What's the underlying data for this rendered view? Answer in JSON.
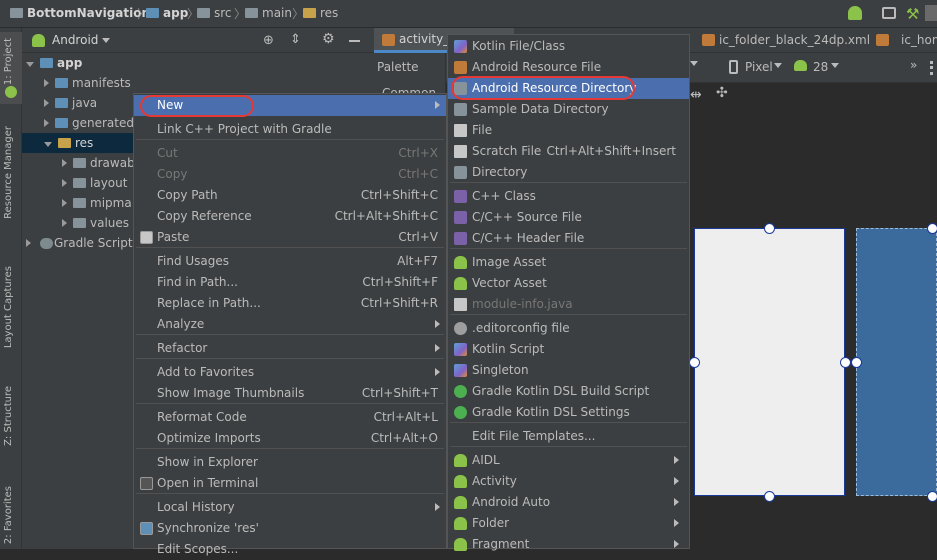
{
  "breadcrumb": {
    "project": "BottomNavigation",
    "module": "app",
    "p1": "src",
    "p2": "main",
    "p3": "res"
  },
  "left_strip": {
    "project": "1: Project",
    "resource_manager": "Resource Manager",
    "layout_captures": "Layout Captures",
    "structure": "Z: Structure",
    "favorites": "2: Favorites"
  },
  "project_panel": {
    "view_mode": "Android",
    "tree": [
      {
        "label": "app"
      },
      {
        "label": "manifests"
      },
      {
        "label": "java"
      },
      {
        "label": "generated"
      },
      {
        "label": "res"
      },
      {
        "label": "drawab"
      },
      {
        "label": "layout"
      },
      {
        "label": "mipma"
      },
      {
        "label": "values"
      },
      {
        "label": "Gradle Scripts"
      }
    ]
  },
  "editor": {
    "tabs": [
      "activity_m",
      "ic_folder_black_24dp.xml",
      "ic_hom"
    ],
    "palette": "Palette",
    "palette_item": "Common",
    "device": "Pixel",
    "api": "28"
  },
  "context_menu": [
    {
      "label": "New",
      "sc": "",
      "sub": true
    },
    {
      "label": "Link C++ Project with Gradle",
      "sc": ""
    },
    {
      "label": "Cut",
      "sc": "Ctrl+X",
      "disabled": true
    },
    {
      "label": "Copy",
      "sc": "Ctrl+C",
      "disabled": true
    },
    {
      "label": "Copy Path",
      "sc": "Ctrl+Shift+C"
    },
    {
      "label": "Copy Reference",
      "sc": "Ctrl+Alt+Shift+C"
    },
    {
      "label": "Paste",
      "sc": "Ctrl+V"
    },
    {
      "label": "Find Usages",
      "sc": "Alt+F7"
    },
    {
      "label": "Find in Path...",
      "sc": "Ctrl+Shift+F"
    },
    {
      "label": "Replace in Path...",
      "sc": "Ctrl+Shift+R"
    },
    {
      "label": "Analyze",
      "sc": "",
      "sub": true
    },
    {
      "label": "Refactor",
      "sc": "",
      "sub": true
    },
    {
      "label": "Add to Favorites",
      "sc": "",
      "sub": true
    },
    {
      "label": "Show Image Thumbnails",
      "sc": "Ctrl+Shift+T"
    },
    {
      "label": "Reformat Code",
      "sc": "Ctrl+Alt+L"
    },
    {
      "label": "Optimize Imports",
      "sc": "Ctrl+Alt+O"
    },
    {
      "label": "Show in Explorer",
      "sc": ""
    },
    {
      "label": "Open in Terminal",
      "sc": ""
    },
    {
      "label": "Local History",
      "sc": "",
      "sub": true
    },
    {
      "label": "Synchronize 'res'",
      "sc": ""
    },
    {
      "label": "Edit Scopes...",
      "sc": ""
    }
  ],
  "new_submenu": [
    {
      "label": "Kotlin File/Class",
      "icon": "kotlin-icon"
    },
    {
      "label": "Android Resource File",
      "icon": "xml-icon"
    },
    {
      "label": "Android Resource Directory",
      "icon": "folder-icon"
    },
    {
      "label": "Sample Data Directory",
      "icon": "folder-icon"
    },
    {
      "label": "File",
      "icon": "file-icon"
    },
    {
      "label": "Scratch File",
      "sc": "Ctrl+Alt+Shift+Insert",
      "icon": "scratch-icon"
    },
    {
      "label": "Directory",
      "icon": "folder-icon"
    },
    {
      "label": "C++ Class",
      "icon": "cpp-icon"
    },
    {
      "label": "C/C++ Source File",
      "icon": "cpp-icon"
    },
    {
      "label": "C/C++ Header File",
      "icon": "cpp-icon"
    },
    {
      "label": "Image Asset",
      "icon": "android-icon"
    },
    {
      "label": "Vector Asset",
      "icon": "android-icon"
    },
    {
      "label": "module-info.java",
      "icon": "java-icon",
      "disabled": true
    },
    {
      "label": ".editorconfig file",
      "icon": "gear-icon"
    },
    {
      "label": "Kotlin Script",
      "icon": "kotlin-icon"
    },
    {
      "label": "Singleton",
      "icon": "kotlin-icon"
    },
    {
      "label": "Gradle Kotlin DSL Build Script",
      "icon": "gradle-icon"
    },
    {
      "label": "Gradle Kotlin DSL Settings",
      "icon": "gradle-icon"
    },
    {
      "label": "Edit File Templates...",
      "icon": ""
    },
    {
      "label": "AIDL",
      "icon": "android-icon",
      "sub": true
    },
    {
      "label": "Activity",
      "icon": "android-icon",
      "sub": true
    },
    {
      "label": "Android Auto",
      "icon": "android-icon",
      "sub": true
    },
    {
      "label": "Folder",
      "icon": "android-icon",
      "sub": true
    },
    {
      "label": "Fragment",
      "icon": "android-icon",
      "sub": true
    }
  ],
  "colors": {
    "selection": "#4b6eaf",
    "highlight_oval": "#e53935",
    "blueprint": "#3a6b9c"
  }
}
